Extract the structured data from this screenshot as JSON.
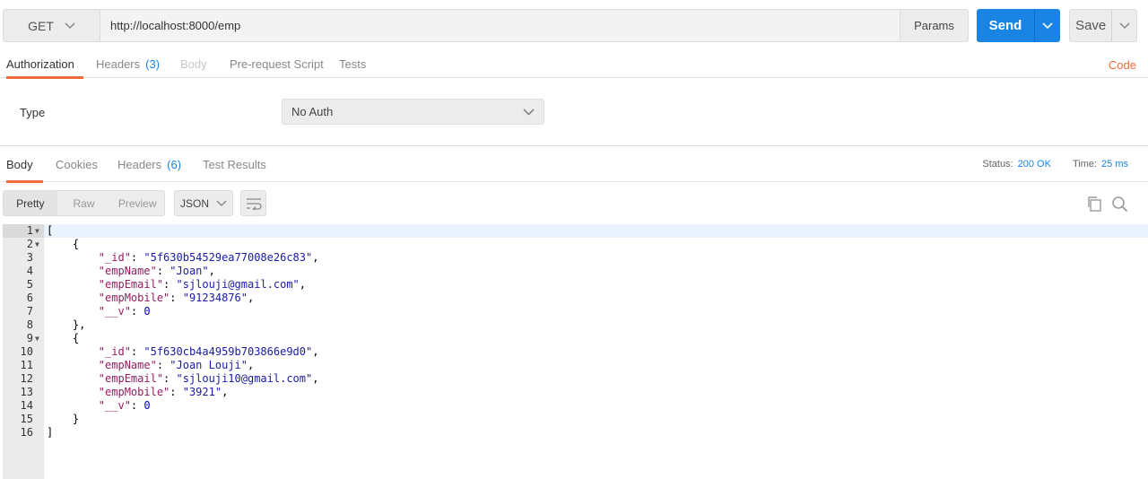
{
  "request": {
    "method": "GET",
    "url": "http://localhost:8000/emp",
    "params_label": "Params",
    "send_label": "Send",
    "save_label": "Save"
  },
  "request_tabs": {
    "authorization": "Authorization",
    "headers": "Headers",
    "headers_count": "(3)",
    "body": "Body",
    "pre_request": "Pre-request Script",
    "tests": "Tests",
    "code_link": "Code"
  },
  "auth": {
    "type_label": "Type",
    "type_value": "No Auth"
  },
  "response_tabs": {
    "body": "Body",
    "cookies": "Cookies",
    "headers": "Headers",
    "headers_count": "(6)",
    "test_results": "Test Results"
  },
  "status": {
    "status_label": "Status:",
    "status_value": "200 OK",
    "time_label": "Time:",
    "time_value": "25 ms"
  },
  "viewer": {
    "pretty": "Pretty",
    "raw": "Raw",
    "preview": "Preview",
    "format": "JSON"
  },
  "response_body": [
    {
      "ln": "1",
      "fold": true
    },
    {
      "ln": "2",
      "fold": true
    },
    {
      "ln": "3",
      "key": "\"_id\"",
      "value": "\"5f630b54529ea77008e26c83\"",
      "type": "s",
      "comma": true
    },
    {
      "ln": "4",
      "key": "\"empName\"",
      "value": "\"Joan\"",
      "type": "s",
      "comma": true
    },
    {
      "ln": "5",
      "key": "\"empEmail\"",
      "value": "\"sjlouji@gmail.com\"",
      "type": "s",
      "comma": true
    },
    {
      "ln": "6",
      "key": "\"empMobile\"",
      "value": "\"91234876\"",
      "type": "s",
      "comma": true
    },
    {
      "ln": "7",
      "key": "\"__v\"",
      "value": "0",
      "type": "n",
      "comma": false
    },
    {
      "ln": "8"
    },
    {
      "ln": "9",
      "fold": true
    },
    {
      "ln": "10",
      "key": "\"_id\"",
      "value": "\"5f630cb4a4959b703866e9d0\"",
      "type": "s",
      "comma": true
    },
    {
      "ln": "11",
      "key": "\"empName\"",
      "value": "\"Joan Louji\"",
      "type": "s",
      "comma": true
    },
    {
      "ln": "12",
      "key": "\"empEmail\"",
      "value": "\"sjlouji10@gmail.com\"",
      "type": "s",
      "comma": true
    },
    {
      "ln": "13",
      "key": "\"empMobile\"",
      "value": "\"3921\"",
      "type": "s",
      "comma": true
    },
    {
      "ln": "14",
      "key": "\"__v\"",
      "value": "0",
      "type": "n",
      "comma": false
    },
    {
      "ln": "15"
    },
    {
      "ln": "16"
    }
  ]
}
